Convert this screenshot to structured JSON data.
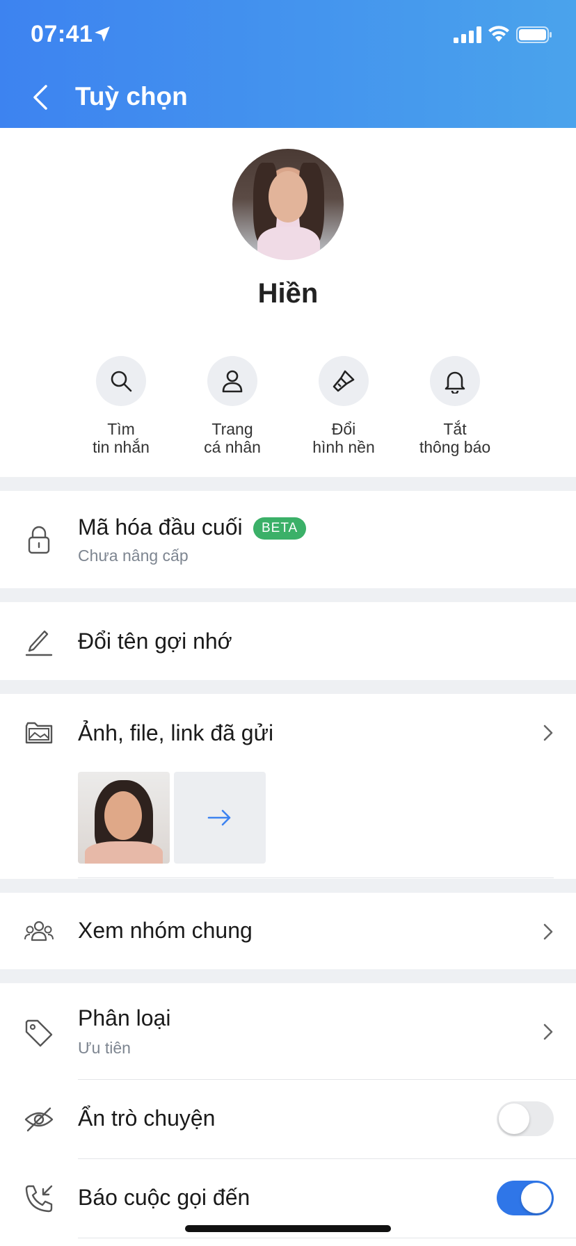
{
  "status_bar": {
    "time": "07:41"
  },
  "header": {
    "title": "Tuỳ chọn"
  },
  "profile": {
    "name": "Hiền"
  },
  "actions": [
    {
      "label": "Tìm\ntin nhắn",
      "icon": "search-icon"
    },
    {
      "label": "Trang\ncá nhân",
      "icon": "person-icon"
    },
    {
      "label": "Đổi\nhình nền",
      "icon": "paint-brush-icon"
    },
    {
      "label": "Tắt\nthông báo",
      "icon": "bell-icon"
    }
  ],
  "encryption": {
    "title": "Mã hóa đầu cuối",
    "badge": "BETA",
    "subtitle": "Chưa nâng cấp"
  },
  "rename": {
    "title": "Đổi tên gợi nhớ"
  },
  "media": {
    "title": "Ảnh, file, link đã gửi"
  },
  "groups": {
    "title": "Xem nhóm chung"
  },
  "category": {
    "title": "Phân loại",
    "subtitle": "Ưu tiên"
  },
  "hide_chat": {
    "title": "Ẩn trò chuyện",
    "enabled": false
  },
  "incoming_call": {
    "title": "Báo cuộc gọi đến",
    "enabled": true
  },
  "colors": {
    "header_start": "#3d83f0",
    "header_end": "#4aa3ec",
    "accent": "#2f76e8",
    "badge": "#3bb068"
  }
}
